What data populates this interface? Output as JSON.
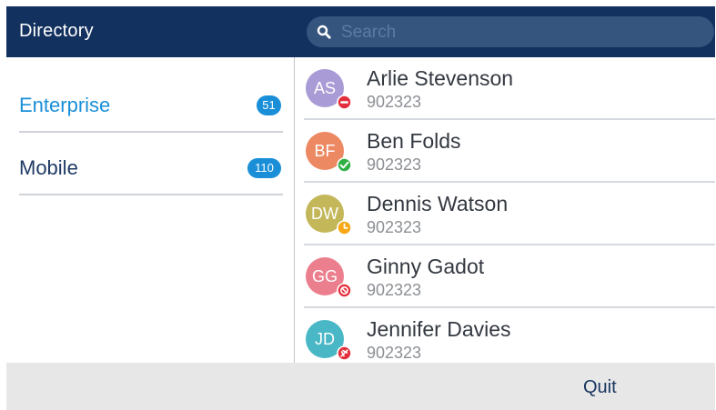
{
  "header": {
    "title": "Directory",
    "search_placeholder": "Search",
    "search_value": ""
  },
  "categories": [
    {
      "label": "Enterprise",
      "count": "51",
      "selected": true
    },
    {
      "label": "Mobile",
      "count": "110",
      "selected": false
    }
  ],
  "contacts": [
    {
      "initials": "AS",
      "name": "Arlie Stevenson",
      "number": "902323",
      "avatar_color": "#a99bd5",
      "status": "do-not-disturb"
    },
    {
      "initials": "BF",
      "name": "Ben Folds",
      "number": "902323",
      "avatar_color": "#ec8963",
      "status": "available"
    },
    {
      "initials": "DW",
      "name": "Dennis Watson",
      "number": "902323",
      "avatar_color": "#c3b75a",
      "status": "away"
    },
    {
      "initials": "GG",
      "name": "Ginny Gadot",
      "number": "902323",
      "avatar_color": "#ec7f8e",
      "status": "blocked"
    },
    {
      "initials": "JD",
      "name": "Jennifer Davies",
      "number": "902323",
      "avatar_color": "#49b7c6",
      "status": "out-of-office"
    }
  ],
  "footer": {
    "quit_label": "Quit"
  },
  "colors": {
    "header_bg": "#12315f",
    "selected_text": "#1a8fd8",
    "unselected_text": "#1f3a64",
    "badge_bg": "#1a8fd8",
    "status_red": "#e32f3c",
    "status_green": "#2fb043",
    "status_amber": "#f7a814"
  }
}
